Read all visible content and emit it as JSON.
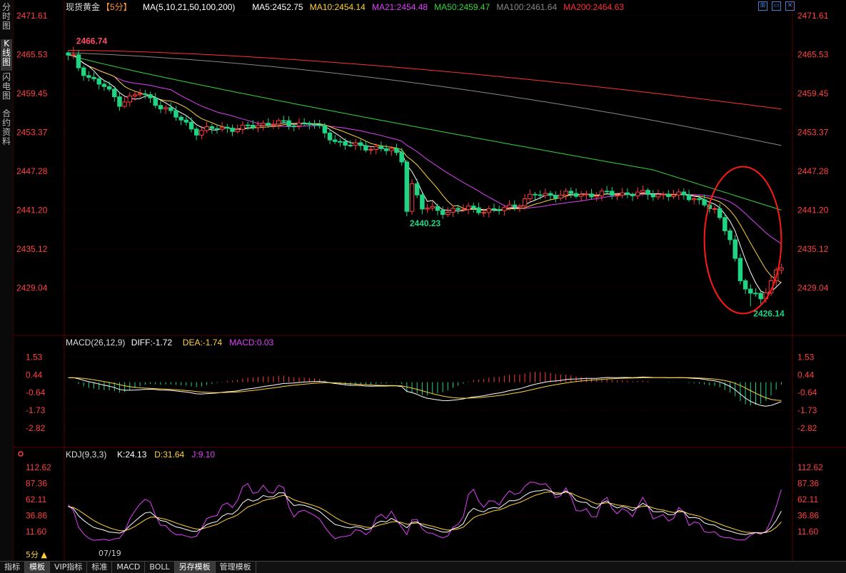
{
  "left_tabs": [
    "分时图",
    "K线图",
    "闪电图",
    "合约资料"
  ],
  "active_left_tab": 1,
  "bottom_tabs": [
    "指标",
    "模板",
    "VIP指标",
    "标准",
    "MACD",
    "BOLL",
    "另存模板",
    "管理模板"
  ],
  "active_bottom_tabs": [
    1,
    6
  ],
  "period_label": "5分 ▲",
  "date_label": "07/19",
  "colors": {
    "up": "#ff3b3b",
    "down": "#1fd483",
    "ma5": "#ffffff",
    "ma10": "#ffd23a",
    "ma21": "#e040fb",
    "ma50": "#36d43a",
    "ma100": "#888888",
    "ma200": "#ff3030",
    "axis": "#ff4040",
    "grid": "#3a0000"
  },
  "chart_data": [
    {
      "type": "candlestick",
      "title_symbol": "现货黄金",
      "period": "【5分】",
      "ma_legend": [
        {
          "name": "MA(5,10,21,50,100,200)",
          "color": "#ffffff"
        },
        {
          "name": "MA5:2452.75",
          "color": "#ffffff"
        },
        {
          "name": "MA10:2454.14",
          "color": "#ffd23a"
        },
        {
          "name": "MA21:2454.48",
          "color": "#e040fb"
        },
        {
          "name": "MA50:2459.47",
          "color": "#36d43a"
        },
        {
          "name": "MA100:2461.64",
          "color": "#888888"
        },
        {
          "name": "MA200:2464.63",
          "color": "#ff3030"
        }
      ],
      "y_ticks": [
        2471.61,
        2465.53,
        2459.45,
        2453.37,
        2447.28,
        2441.2,
        2435.12,
        2429.04
      ],
      "ylim": [
        2424.5,
        2471.61
      ],
      "annotations": [
        {
          "text": "2466.74",
          "index": 1,
          "value": 2466.74,
          "color": "#ff4a6a"
        },
        {
          "text": "2440.23",
          "index": 66,
          "value": 2440.23,
          "color": "#1fd483"
        },
        {
          "text": "2426.14",
          "index": 133,
          "value": 2426.14,
          "color": "#1fd483"
        }
      ],
      "highlight": {
        "index_from": 124,
        "index_to": 139,
        "value_from": 2425,
        "value_to": 2448
      }
    },
    {
      "type": "bar-line",
      "legend": [
        {
          "name": "MACD(26,12,9)",
          "color": "#dddddd"
        },
        {
          "name": "DIFF:-1.72",
          "color": "#ffffff"
        },
        {
          "name": "DEA:-1.74",
          "color": "#ffd23a"
        },
        {
          "name": "MACD:0.03",
          "color": "#e040fb"
        }
      ],
      "y_ticks": [
        1.53,
        0.44,
        -0.64,
        -1.73,
        -2.82
      ],
      "ylim": [
        -3.9,
        1.9
      ]
    },
    {
      "type": "line",
      "legend": [
        {
          "name": "KDJ(9,3,3)",
          "color": "#dddddd"
        },
        {
          "name": "K:24.13",
          "color": "#ffffff"
        },
        {
          "name": "D:31.64",
          "color": "#ffd23a"
        },
        {
          "name": "J:9.10",
          "color": "#e040fb"
        }
      ],
      "y_ticks": [
        112.62,
        87.36,
        62.11,
        36.86,
        11.6
      ],
      "ylim": [
        -5,
        118
      ]
    }
  ]
}
